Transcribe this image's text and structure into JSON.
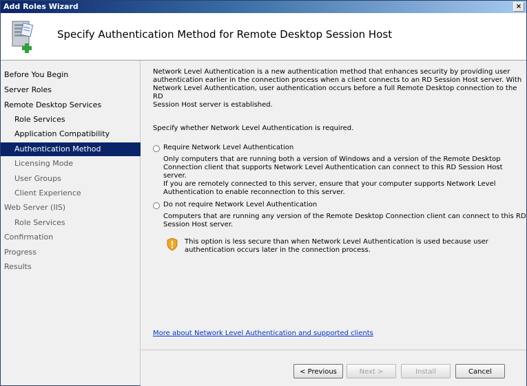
{
  "window": {
    "title": "Add Roles Wizard",
    "close_glyph": "×"
  },
  "header": {
    "heading": "Specify Authentication Method for Remote Desktop Session Host",
    "icon": "server-wizard-icon"
  },
  "sidebar": {
    "items": [
      {
        "label": "Before You Begin",
        "level": 0,
        "state": "done"
      },
      {
        "label": "Server Roles",
        "level": 0,
        "state": "done"
      },
      {
        "label": "Remote Desktop Services",
        "level": 0,
        "state": "done"
      },
      {
        "label": "Role Services",
        "level": 1,
        "state": "done"
      },
      {
        "label": "Application Compatibility",
        "level": 1,
        "state": "done"
      },
      {
        "label": "Authentication Method",
        "level": 1,
        "state": "selected"
      },
      {
        "label": "Licensing Mode",
        "level": 1,
        "state": "pending"
      },
      {
        "label": "User Groups",
        "level": 1,
        "state": "pending"
      },
      {
        "label": "Client Experience",
        "level": 1,
        "state": "pending"
      },
      {
        "label": "Web Server (IIS)",
        "level": 0,
        "state": "pending"
      },
      {
        "label": "Role Services",
        "level": 1,
        "state": "pending"
      },
      {
        "label": "Confirmation",
        "level": 0,
        "state": "pending"
      },
      {
        "label": "Progress",
        "level": 0,
        "state": "pending"
      },
      {
        "label": "Results",
        "level": 0,
        "state": "pending"
      }
    ]
  },
  "content": {
    "intro_lines": [
      "Network Level Authentication is a new authentication method that enhances security by providing user",
      "authentication earlier in the connection process when a client connects to an RD Session Host server. With",
      "Network Level Authentication, user authentication occurs before a full Remote Desktop connection to the RD",
      "Session Host server is established."
    ],
    "prompt": "Specify whether Network Level Authentication is required.",
    "option1": {
      "label": "Require Network Level Authentication",
      "selected": false,
      "desc_lines": [
        "Only computers that are running both a version of Windows and a version of the Remote Desktop",
        "Connection client that supports Network Level Authentication can connect to this RD Session Host server.",
        "If you are remotely connected to this server, ensure that your computer supports Network Level",
        "Authentication to enable reconnection to this server."
      ]
    },
    "option2": {
      "label": "Do not require Network Level Authentication",
      "selected": false,
      "desc_lines": [
        "Computers that are running any version of the Remote Desktop Connection client can connect to this RD",
        "Session Host server."
      ],
      "warning_lines": [
        "This option is less secure than when Network Level Authentication is used because user",
        "authentication occurs later in the connection process."
      ]
    },
    "link": "More about Network Level Authentication and supported clients"
  },
  "buttons": {
    "previous": "< Previous",
    "next": "Next >",
    "install": "Install",
    "cancel": "Cancel",
    "next_enabled": false,
    "install_enabled": false
  }
}
